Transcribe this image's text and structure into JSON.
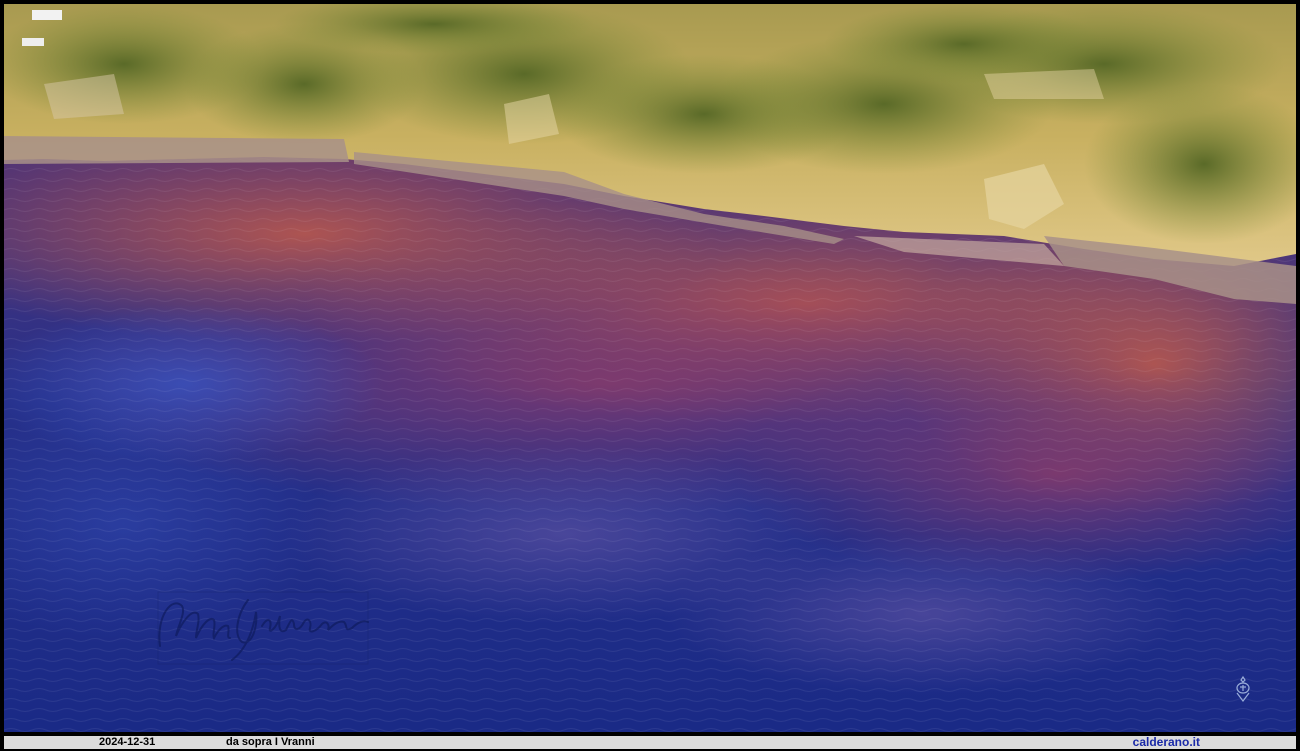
{
  "caption": {
    "date": "2024-12-31",
    "title": "da sopra I Vranni",
    "site": "calderano.it"
  },
  "photo": {
    "subject": "",
    "signature_text": "Many Calderano",
    "colors": {
      "sea_deep": "#1b2a88",
      "sea_reflection": "#8a3a5a",
      "cliff_light": "#d8c070",
      "vegetation": "#6a7a30",
      "rocks": "#a89080",
      "caption_bar": "#dcdcdc",
      "site_link": "#1a2aa8"
    }
  }
}
